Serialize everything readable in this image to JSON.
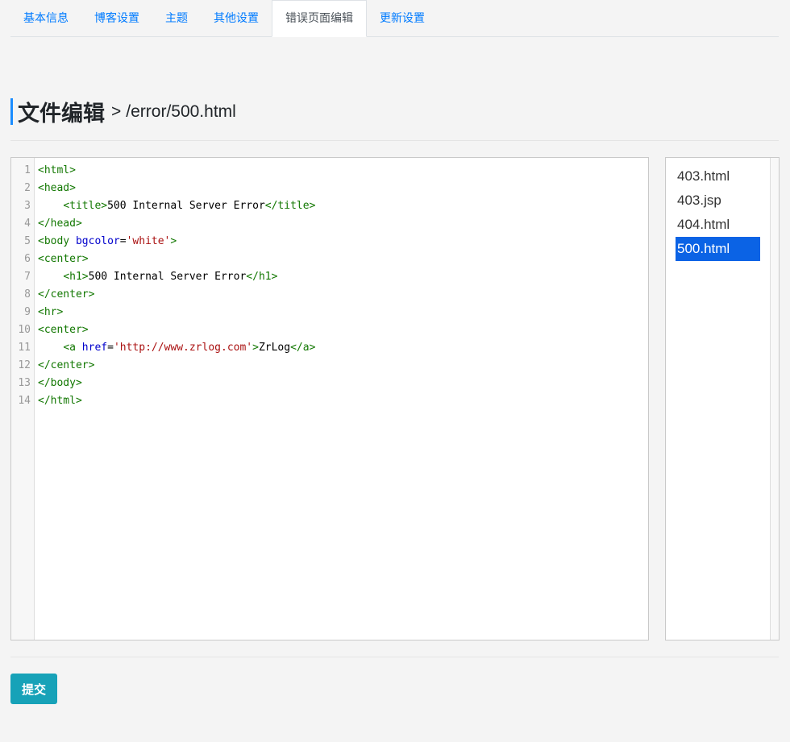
{
  "tabs": [
    {
      "label": "基本信息"
    },
    {
      "label": "博客设置"
    },
    {
      "label": "主题"
    },
    {
      "label": "其他设置"
    },
    {
      "label": "错误页面编辑"
    },
    {
      "label": "更新设置"
    }
  ],
  "active_tab": "错误页面编辑",
  "heading": {
    "title": "文件编辑",
    "separator": ">",
    "path": "/error/500.html"
  },
  "editor": {
    "line_numbers": [
      "1",
      "2",
      "3",
      "4",
      "5",
      "6",
      "7",
      "8",
      "9",
      "10",
      "11",
      "12",
      "13",
      "14"
    ],
    "lines": [
      [
        {
          "t": "tag",
          "v": "<html>"
        }
      ],
      [
        {
          "t": "tag",
          "v": "<head>"
        }
      ],
      [
        {
          "t": "txt",
          "v": "    "
        },
        {
          "t": "tag",
          "v": "<title>"
        },
        {
          "t": "txt",
          "v": "500 Internal Server Error"
        },
        {
          "t": "tag",
          "v": "</title>"
        }
      ],
      [
        {
          "t": "tag",
          "v": "</head>"
        }
      ],
      [
        {
          "t": "tag",
          "v": "<body "
        },
        {
          "t": "attr",
          "v": "bgcolor"
        },
        {
          "t": "txt",
          "v": "="
        },
        {
          "t": "str",
          "v": "'white'"
        },
        {
          "t": "tag",
          "v": ">"
        }
      ],
      [
        {
          "t": "tag",
          "v": "<center>"
        }
      ],
      [
        {
          "t": "txt",
          "v": "    "
        },
        {
          "t": "tag",
          "v": "<h1>"
        },
        {
          "t": "txt",
          "v": "500 Internal Server Error"
        },
        {
          "t": "tag",
          "v": "</h1>"
        }
      ],
      [
        {
          "t": "tag",
          "v": "</center>"
        }
      ],
      [
        {
          "t": "tag",
          "v": "<hr>"
        }
      ],
      [
        {
          "t": "tag",
          "v": "<center>"
        }
      ],
      [
        {
          "t": "txt",
          "v": "    "
        },
        {
          "t": "tag",
          "v": "<a "
        },
        {
          "t": "attr",
          "v": "href"
        },
        {
          "t": "txt",
          "v": "="
        },
        {
          "t": "str",
          "v": "'http://www.zrlog.com'"
        },
        {
          "t": "tag",
          "v": ">"
        },
        {
          "t": "txt",
          "v": "ZrLog"
        },
        {
          "t": "tag",
          "v": "</a>"
        }
      ],
      [
        {
          "t": "tag",
          "v": "</center>"
        }
      ],
      [
        {
          "t": "tag",
          "v": "</body>"
        }
      ],
      [
        {
          "t": "tag",
          "v": "</html>"
        }
      ]
    ]
  },
  "files": {
    "items": [
      "403.html",
      "403.jsp",
      "404.html",
      "500.html"
    ],
    "selected": "500.html"
  },
  "submit_label": "提交",
  "colors": {
    "accent": "#1a8cff",
    "tab_link": "#007bff",
    "selected_file": "#0b63e5",
    "submit_button": "#17a2b8",
    "code_tag": "#117700",
    "code_attr": "#0000cc",
    "code_string": "#aa1111"
  }
}
